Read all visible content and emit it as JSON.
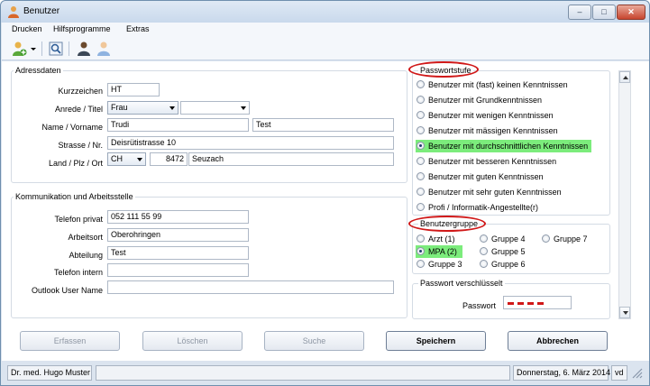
{
  "window": {
    "title": "Benutzer",
    "icon": "user-icon"
  },
  "menu": {
    "print": "Drucken",
    "tools": "Hilfsprogramme",
    "extras": "Extras"
  },
  "toolbar": {
    "icons": [
      "add-user-icon",
      "dropdown-arrow-icon",
      "search-list-icon",
      "user-dark-icon",
      "user-light-icon"
    ]
  },
  "address": {
    "title": "Adressdaten",
    "abbr_label": "Kurzzeichen",
    "abbr_value": "HT",
    "salutation_label": "Anrede / Titel",
    "salutation_value": "Frau",
    "title_value": "",
    "name_label": "Name / Vorname",
    "last_name": "Trudi",
    "first_name": "Test",
    "street_label": "Strasse / Nr.",
    "street_value": "Deisrütistrasse 10",
    "location_label": "Land / Plz / Ort",
    "country": "CH",
    "zip": "8472",
    "city": "Seuzach"
  },
  "communication": {
    "title": "Kommunikation und Arbeitsstelle",
    "phone_private_label": "Telefon privat",
    "phone_private_value": "052 111 55 99",
    "workplace_label": "Arbeitsort",
    "workplace_value": "Oberohringen",
    "department_label": "Abteilung",
    "department_value": "Test",
    "phone_internal_label": "Telefon intern",
    "phone_internal_value": "",
    "outlook_label": "Outlook User Name",
    "outlook_value": ""
  },
  "password_level": {
    "title": "Passwortstufe",
    "options": [
      "Benutzer mit (fast) keinen Kenntnissen",
      "Benutzer mit Grundkenntnissen",
      "Benutzer mit wenigen Kenntnissen",
      "Benutzer mit mässigen Kenntnissen",
      "Benutzer mit durchschnittlichen Kenntnissen",
      "Benutzer mit besseren Kenntnissen",
      "Benutzer mit guten Kenntnissen",
      "Benutzer mit sehr guten Kenntnissen",
      "Profi / Informatik-Angestellte(r)"
    ],
    "selected_index": 4
  },
  "user_group": {
    "title": "Benutzergruppe",
    "options": [
      "Arzt (1)",
      "MPA (2)",
      "Gruppe 3",
      "Gruppe 4",
      "Gruppe 5",
      "Gruppe 6",
      "Gruppe 7"
    ],
    "selected_index": 1
  },
  "password_encrypted": {
    "title": "Passwort verschlüsselt",
    "label": "Passwort"
  },
  "buttons": {
    "record": "Erfassen",
    "delete": "Löschen",
    "search": "Suche",
    "save": "Speichern",
    "cancel": "Abbrechen"
  },
  "status": {
    "user": "Dr. med. Hugo Muster",
    "date": "Donnerstag, 6. März 2014",
    "short": "vd"
  },
  "colors": {
    "highlight": "#7cec7c",
    "annotation_circle": "#d01818"
  }
}
